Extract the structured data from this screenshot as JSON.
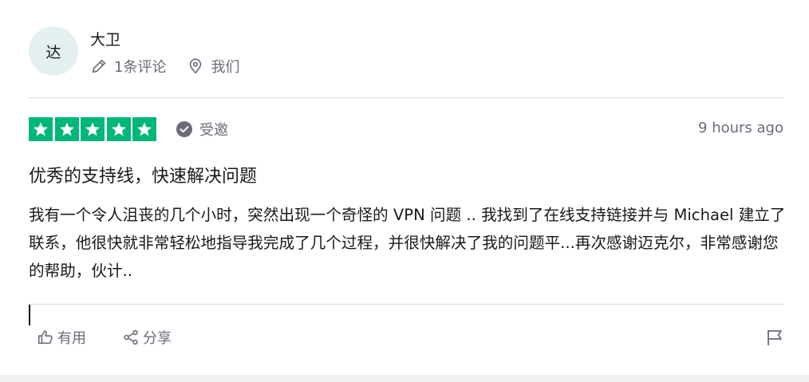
{
  "reviewer": {
    "avatar_initial": "达",
    "name": "大卫",
    "reviews_count": "1条评论",
    "location": "我们"
  },
  "rating": {
    "stars": 5,
    "star_color": "#00b67a",
    "badge": "受邀",
    "time": "9 hours ago"
  },
  "review": {
    "title": "优秀的支持线，快速解决问题",
    "body": "我有一个令人沮丧的几个小时，突然出现一个奇怪的 VPN 问题 .. 我找到了在线支持链接并与 Michael 建立了联系，他很快就非常轻松地指导我完成了几个过程，并很快解决了我的问题平...再次感谢迈克尔，非常感谢您的帮助，伙计.."
  },
  "actions": {
    "like_label": "有用",
    "share_label": "分享"
  },
  "icons": {
    "edit": "pencil-icon",
    "location": "location-pin-icon",
    "verified": "check-circle-icon",
    "like": "thumbs-up-icon",
    "share": "share-icon",
    "flag": "flag-icon"
  }
}
